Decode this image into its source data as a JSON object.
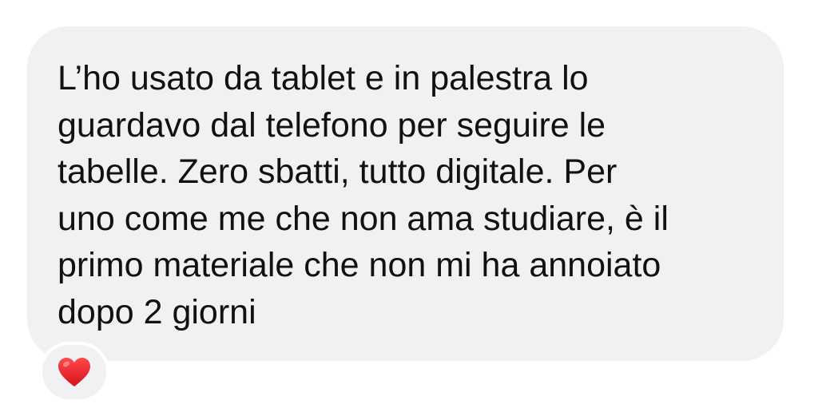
{
  "message": {
    "lines": [
      "L’ho usato da tablet e in palestra lo",
      "guardavo dal telefono per seguire le",
      "tabelle. Zero sbatti, tutto digitale. Per",
      "uno come me che non ama studiare, è il",
      "primo materiale che non mi ha annoiato",
      "dopo 2 giorni"
    ],
    "bubble_color": "#f0f1f3",
    "text_color": "#111111"
  },
  "reaction": {
    "icon": "red-heart-icon",
    "color": "#e8192c"
  }
}
